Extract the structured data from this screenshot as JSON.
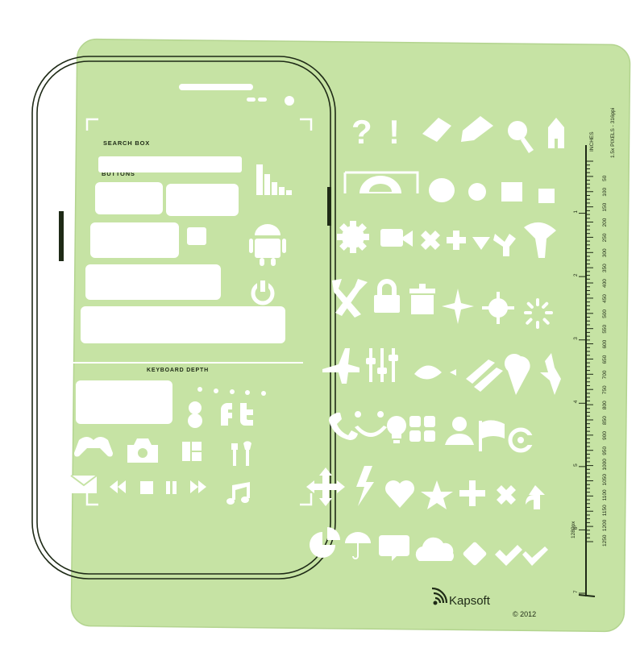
{
  "stencil": {
    "labels": {
      "search_box": "SEARCH BOX",
      "buttons": "BUTTONS",
      "keyboard_depth": "KEYBOARD DEPTH"
    },
    "ruler": {
      "inches_label": "INCHES",
      "pixels_label": "1.5x PIXELS - 316ppi",
      "end_label": "1280px",
      "inch_marks": [
        "1",
        "2",
        "3",
        "4",
        "5",
        "6",
        "7"
      ],
      "pixel_marks": [
        "50",
        "100",
        "150",
        "200",
        "250",
        "300",
        "350",
        "400",
        "450",
        "500",
        "550",
        "600",
        "650",
        "700",
        "750",
        "800",
        "850",
        "900",
        "950",
        "1000",
        "1050",
        "1100",
        "1150",
        "1200",
        "1250"
      ]
    },
    "brand": {
      "logo_text": "Kapsoft",
      "copyright": "© 2012"
    },
    "colors": {
      "sheet": "#c6e3a4",
      "sheet_edge": "#b3d48f",
      "outline": "#1e2a16",
      "cutout": "#ffffff"
    },
    "icons": {
      "left_panel": [
        "bar-chart-icon",
        "android-robot-icon",
        "power-icon",
        "facebook-icon",
        "twitter-icon",
        "game-controller-icon",
        "camera-icon",
        "layout-icon",
        "tools-icon",
        "mail-icon",
        "rewind-icon",
        "stop-icon",
        "pause-icon",
        "fast-forward-icon",
        "music-note-icon"
      ],
      "right_panel": [
        "question-mark-icon",
        "exclamation-icon",
        "eraser-icon",
        "pencil-icon",
        "search-icon",
        "bookmark-icon",
        "loading-arc-icon",
        "circle-icon",
        "square-icon",
        "settings-gear-icon",
        "video-camera-icon",
        "close-icon",
        "plus-icon",
        "triangle-down-icon",
        "merge-icon",
        "funnel-icon",
        "shuffle-icon",
        "lock-icon",
        "trash-icon",
        "sparkle-icon",
        "target-icon",
        "spinner-icon",
        "airplane-icon",
        "sliders-icon",
        "eye-icon",
        "striped-bars-icon",
        "map-pin-icon",
        "bluetooth-icon",
        "phone-icon",
        "smile-icon",
        "lightbulb-icon",
        "grid-icon",
        "person-icon",
        "flag-icon",
        "copyright-icon",
        "move-arrows-icon",
        "lightning-icon",
        "heart-icon",
        "star-icon",
        "close-icon-2",
        "arrow-up-icon",
        "pie-chart-icon",
        "umbrella-icon",
        "speech-bubble-icon",
        "cloud-icon",
        "diamond-icon",
        "checkmark-icon"
      ]
    }
  }
}
